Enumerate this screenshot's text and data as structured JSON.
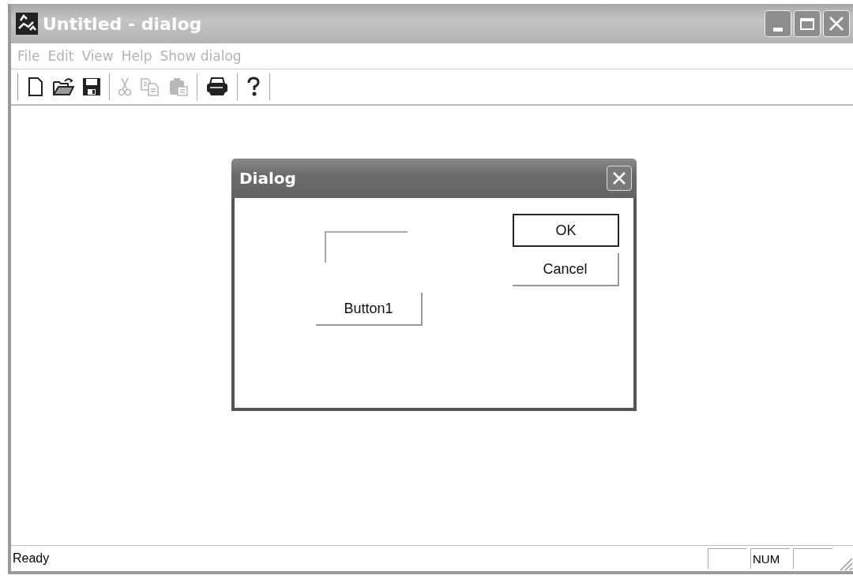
{
  "window": {
    "title": "Untitled - dialog"
  },
  "menu": [
    {
      "label": "File",
      "disabled": true
    },
    {
      "label": "Edit",
      "disabled": true
    },
    {
      "label": "View",
      "disabled": true
    },
    {
      "label": "Help",
      "disabled": true
    },
    {
      "label": "Show dialog",
      "disabled": true
    }
  ],
  "toolbar_groups": [
    [
      {
        "disabled": false
      },
      {
        "disabled": false
      },
      {
        "disabled": false
      }
    ],
    [
      {
        "disabled": true
      },
      {
        "disabled": true
      },
      {
        "disabled": true
      }
    ],
    [
      {
        "disabled": false
      }
    ],
    [
      {
        "disabled": false
      }
    ]
  ],
  "dialog": {
    "title": "Dialog",
    "action_button": "Button1",
    "buttons": [
      {
        "label": "OK",
        "default": true
      },
      {
        "label": "Cancel",
        "default": false
      }
    ]
  },
  "status_bar": {
    "text": "Ready",
    "indicator": "NUM"
  }
}
